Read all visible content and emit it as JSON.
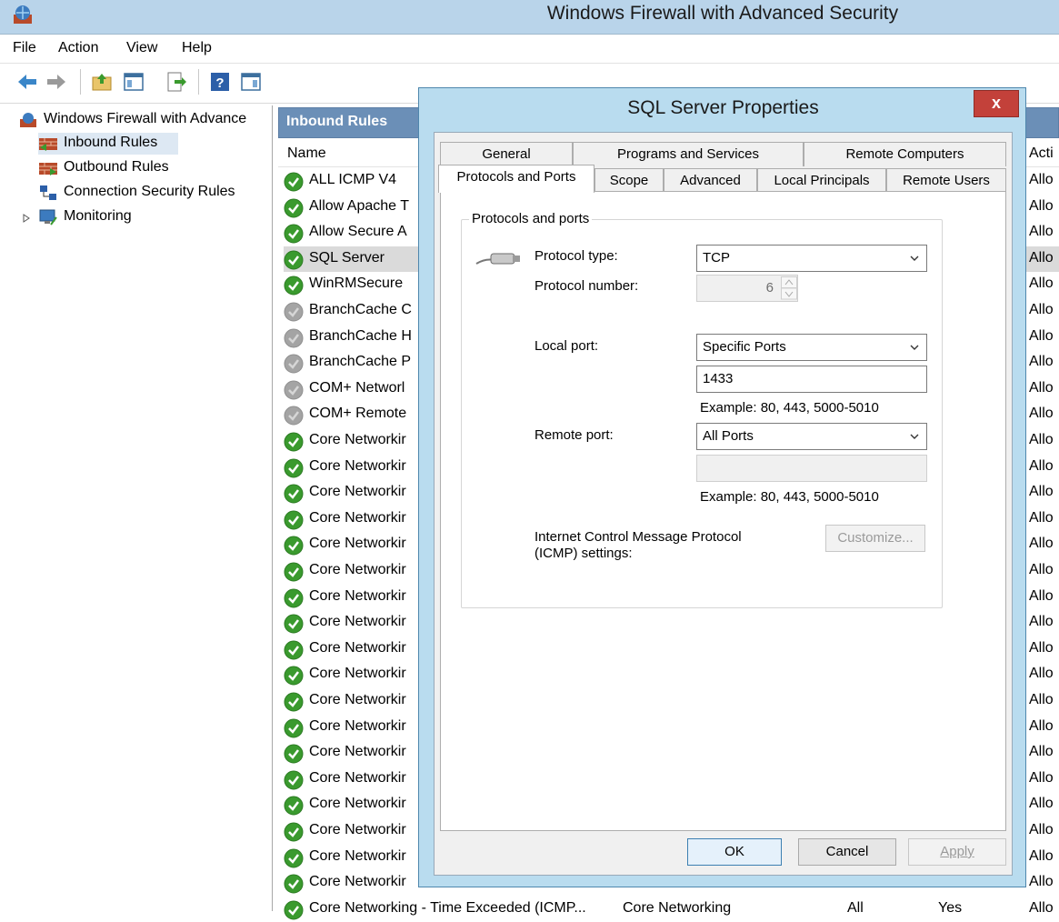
{
  "window": {
    "title": "Windows Firewall with Advanced Security"
  },
  "menu": [
    "File",
    "Action",
    "View",
    "Help"
  ],
  "toolbar": [
    "back-icon",
    "forward-icon",
    "up-folder-icon",
    "show-hide-tree-icon",
    "export-list-icon",
    "help-icon",
    "show-hide-action-pane-icon"
  ],
  "tree": {
    "root": "Windows Firewall with Advance",
    "items": [
      "Inbound Rules",
      "Outbound Rules",
      "Connection Security Rules",
      "Monitoring"
    ]
  },
  "list": {
    "header": "Inbound Rules",
    "columns": {
      "name": "Name",
      "action": "Acti"
    },
    "rows": [
      {
        "name": "ALL ICMP V4",
        "enabled": true,
        "action": "Allo"
      },
      {
        "name": "Allow Apache T",
        "enabled": true,
        "action": "Allo"
      },
      {
        "name": "Allow Secure A",
        "enabled": true,
        "action": "Allo"
      },
      {
        "name": "SQL Server",
        "enabled": true,
        "action": "Allo"
      },
      {
        "name": "WinRMSecure",
        "enabled": true,
        "action": "Allo"
      },
      {
        "name": "BranchCache C",
        "enabled": false,
        "action": "Allo"
      },
      {
        "name": "BranchCache H",
        "enabled": false,
        "action": "Allo"
      },
      {
        "name": "BranchCache P",
        "enabled": false,
        "action": "Allo"
      },
      {
        "name": "COM+ Networl",
        "enabled": false,
        "action": "Allo"
      },
      {
        "name": "COM+ Remote",
        "enabled": false,
        "action": "Allo"
      },
      {
        "name": "Core Networkir",
        "enabled": true,
        "action": "Allo"
      },
      {
        "name": "Core Networkir",
        "enabled": true,
        "action": "Allo"
      },
      {
        "name": "Core Networkir",
        "enabled": true,
        "action": "Allo"
      },
      {
        "name": "Core Networkir",
        "enabled": true,
        "action": "Allo"
      },
      {
        "name": "Core Networkir",
        "enabled": true,
        "action": "Allo"
      },
      {
        "name": "Core Networkir",
        "enabled": true,
        "action": "Allo"
      },
      {
        "name": "Core Networkir",
        "enabled": true,
        "action": "Allo"
      },
      {
        "name": "Core Networkir",
        "enabled": true,
        "action": "Allo"
      },
      {
        "name": "Core Networkir",
        "enabled": true,
        "action": "Allo"
      },
      {
        "name": "Core Networkir",
        "enabled": true,
        "action": "Allo"
      },
      {
        "name": "Core Networkir",
        "enabled": true,
        "action": "Allo"
      },
      {
        "name": "Core Networkir",
        "enabled": true,
        "action": "Allo"
      },
      {
        "name": "Core Networkir",
        "enabled": true,
        "action": "Allo"
      },
      {
        "name": "Core Networkir",
        "enabled": true,
        "action": "Allo"
      },
      {
        "name": "Core Networkir",
        "enabled": true,
        "action": "Allo"
      },
      {
        "name": "Core Networkir",
        "enabled": true,
        "action": "Allo"
      },
      {
        "name": "Core Networkir",
        "enabled": true,
        "action": "Allo"
      },
      {
        "name": "Core Networkir",
        "enabled": true,
        "action": "Allo"
      },
      {
        "name": "Core Networking - Time Exceeded (ICMP...",
        "group": "Core Networking",
        "profile": "All",
        "enabled_text": "Yes",
        "enabled": true,
        "action": "Allo"
      }
    ]
  },
  "dialog": {
    "title": "SQL Server Properties",
    "close": "x",
    "tabs_top": [
      "General",
      "Programs and Services",
      "Remote Computers"
    ],
    "tabs_bottom": [
      "Protocols and Ports",
      "Scope",
      "Advanced",
      "Local Principals",
      "Remote Users"
    ],
    "group_label": "Protocols and ports",
    "protocol_type_label": "Protocol type:",
    "protocol_type_value": "TCP",
    "protocol_number_label": "Protocol number:",
    "protocol_number_value": "6",
    "local_port_label": "Local port:",
    "local_port_mode": "Specific Ports",
    "local_port_value": "1433",
    "local_example": "Example: 80, 443, 5000-5010",
    "remote_port_label": "Remote port:",
    "remote_port_mode": "All Ports",
    "remote_port_value": "",
    "remote_example": "Example: 80, 443, 5000-5010",
    "icmp_label_1": "Internet Control Message Protocol",
    "icmp_label_2": "(ICMP) settings:",
    "customize": "Customize...",
    "ok": "OK",
    "cancel": "Cancel",
    "apply": "Apply"
  }
}
